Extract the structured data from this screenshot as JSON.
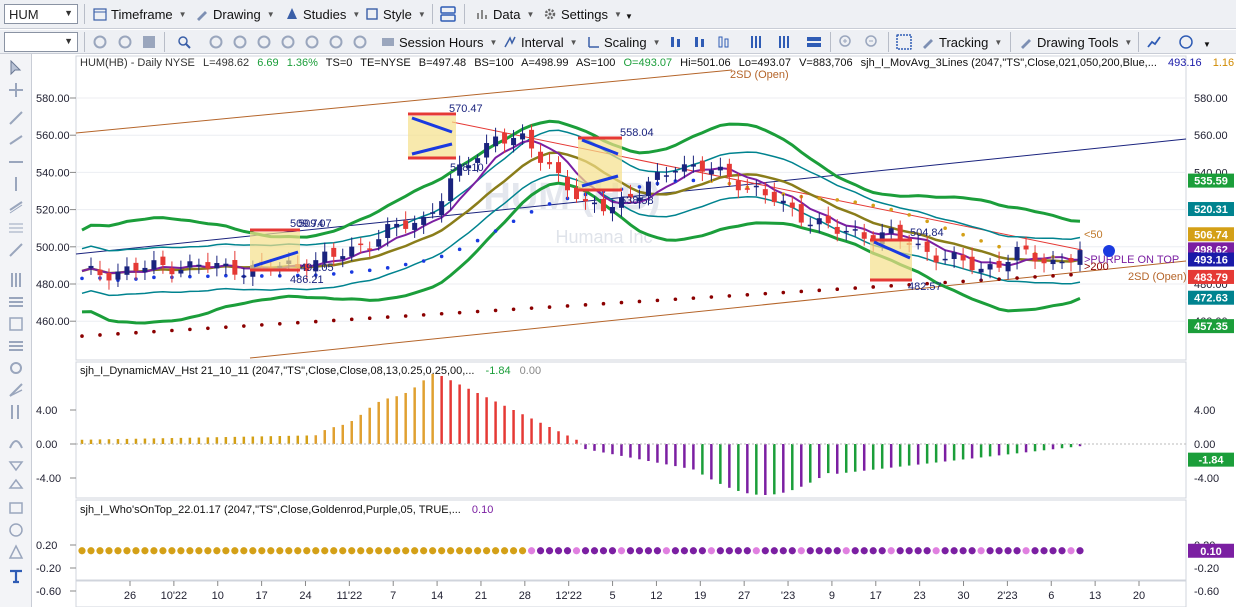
{
  "toolbar1": {
    "symbol": "HUM",
    "timeframe": "Timeframe",
    "drawing": "Drawing",
    "studies": "Studies",
    "style": "Style",
    "data": "Data",
    "settings": "Settings"
  },
  "toolbar2": {
    "session_hours": "Session Hours",
    "interval": "Interval",
    "scaling": "Scaling",
    "tracking": "Tracking",
    "drawing_tools": "Drawing Tools"
  },
  "colors": {
    "accent_blue": "#0000cc",
    "up": "#1a237e",
    "down": "#e53935",
    "band": "#1b9e3a",
    "mid": "#00838f",
    "purple": "#7b1fa2",
    "gold": "#d4a017"
  },
  "header": {
    "symbol_info": "HUM(HB) - Daily  NYSE",
    "L": "L=498.62",
    "chg": "6.69",
    "pct": "1.36%",
    "ts": "TS=0",
    "te": "TE=NYSE",
    "B": "B=497.48",
    "BS": "BS=100",
    "A": "A=498.99",
    "AS": "AS=100",
    "O": "O=493.07",
    "Hi": "Hi=501.06",
    "Lo": "Lo=493.07",
    "V": "V=883,706",
    "study": "sjh_I_MovAvg_3Lines (2047,\"TS\",Close,021,050,200,Blue,...",
    "study_val1": "493.16",
    "study_val2": "1.16"
  },
  "watermark": {
    "symbol": "HUM (HB)",
    "name": "Humana Inc"
  },
  "price_axis": {
    "labels": [
      "580.00",
      "560.00",
      "540.00",
      "520.00",
      "500.00",
      "480.00",
      "460.00"
    ]
  },
  "price_badges": [
    "535.59",
    "520.31",
    "506.74",
    "498.62",
    "493.16",
    "483.79",
    "472.63",
    "457.35"
  ],
  "annotations": {
    "a1": "570.47",
    "a2": "558.04",
    "a3": "548.10",
    "a4": "538.58",
    "a5": "509.74",
    "a6": "509.07",
    "a7": "493.05",
    "a8": "486.21",
    "a9": "504.84",
    "a10": "482.57",
    "sd_top": "2SD (Open)",
    "sd_bot": "2SD (Open)",
    "lt50": "<50",
    "lt200": ">200",
    "purple": ">PURPLE ON TOP"
  },
  "panel2": {
    "title": "sjh_I_DynamicMAV_Hst 21_10_11 (2047,\"TS\",Close,Close,08,13,0.25,0.25,00,...",
    "v1": "-1.84",
    "v2": "0.00",
    "axis": [
      "4.00",
      "0.00",
      "-4.00"
    ],
    "badge": "-1.84"
  },
  "panel3": {
    "title": "sjh_I_Who'sOnTop_22.01.17 (2047,\"TS\",Close,Goldenrod,Purple,05, TRUE,...",
    "v1": "0.10",
    "axis": [
      "0.20",
      "-0.20",
      "-0.60"
    ],
    "badge": "0.10"
  },
  "time_axis": [
    "26",
    "10'22",
    "10",
    "17",
    "24",
    "11'22",
    "7",
    "14",
    "21",
    "28",
    "12'22",
    "5",
    "12",
    "19",
    "27",
    "'23",
    "9",
    "17",
    "23",
    "30",
    "2'23",
    "6",
    "13",
    "20"
  ]
}
